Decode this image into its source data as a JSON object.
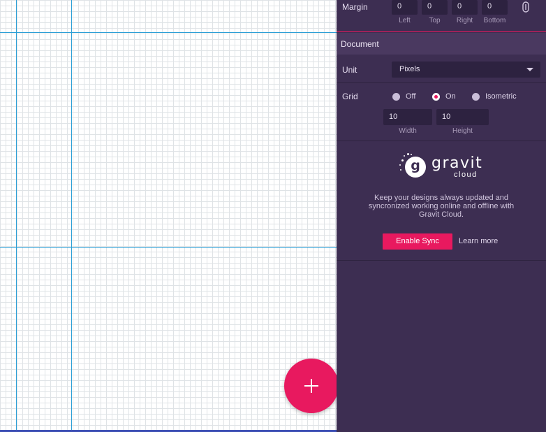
{
  "margin": {
    "label": "Margin",
    "fields": [
      {
        "value": "0",
        "label": "Left"
      },
      {
        "value": "0",
        "label": "Top"
      },
      {
        "value": "0",
        "label": "Right"
      },
      {
        "value": "0",
        "label": "Bottom"
      }
    ],
    "lock_icon": "link-lock-icon"
  },
  "document": {
    "header": "Document",
    "unit_label": "Unit",
    "unit_value": "Pixels",
    "grid_label": "Grid",
    "grid_options": [
      {
        "label": "Off",
        "checked": false
      },
      {
        "label": "On",
        "checked": true
      },
      {
        "label": "Isometric",
        "checked": false
      }
    ],
    "grid_width": {
      "value": "10",
      "label": "Width"
    },
    "grid_height": {
      "value": "10",
      "label": "Height"
    }
  },
  "cloud": {
    "logo_name": "gravit",
    "logo_sub": "cloud",
    "logo_letter": "g",
    "description": "Keep your designs always updated and syncronized working online and offline with Gravit Cloud.",
    "enable_button": "Enable Sync",
    "learn_more": "Learn more"
  },
  "fab": {
    "icon": "plus-icon"
  },
  "colors": {
    "accent": "#e8195f",
    "panel_bg": "#3d2e52",
    "guide": "#2c9fd6"
  }
}
